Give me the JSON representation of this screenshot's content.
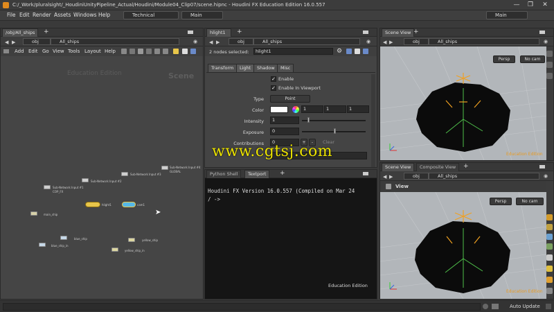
{
  "window": {
    "title": "C:/_Work/pluralsight/_HoudiniUnityPipeline_Actual/Houdini/Module04_Clip07/scene.hipnc - Houdini FX Education Edition 16.0.557"
  },
  "menubar": {
    "items": [
      "File",
      "Edit",
      "Render",
      "Assets",
      "Windows",
      "Help"
    ],
    "desktop": "Technical",
    "desktop2": "Main",
    "desktop_right": "Main"
  },
  "network": {
    "tab": "/obj/All_ships",
    "path_root": "obj",
    "path_node": "All_ships",
    "menu": [
      "Add",
      "Edit",
      "Go",
      "View",
      "Tools",
      "Layout",
      "Help"
    ],
    "watermark": "Education Edition",
    "context": "Scene",
    "nodes": [
      {
        "label": "Sub-Network Input #4",
        "sub": "GLOBAL"
      },
      {
        "label": "Sub-Network Input #3",
        "sub": ""
      },
      {
        "label": "Sub-Network Input #2",
        "sub": ""
      },
      {
        "label": "Sub-Network Input #1",
        "sub": "COP_FX"
      },
      {
        "label": "hlight1",
        "sub": ""
      },
      {
        "label": "cam1",
        "sub": ""
      },
      {
        "label": "main_ship",
        "sub": ""
      },
      {
        "label": "blue_ship",
        "sub": ""
      },
      {
        "label": "yellow_ship",
        "sub": ""
      },
      {
        "label": "blue_ship_in",
        "sub": ""
      },
      {
        "label": "yellow_ship_in",
        "sub": ""
      }
    ]
  },
  "params": {
    "tab": "hlight1",
    "path_root": "obj",
    "path_node": "All_ships",
    "selected": "2 nodes selected:",
    "node_name": "hlight1",
    "tabs": [
      "Transform",
      "Light",
      "Shadow",
      "Misc"
    ],
    "enable": "Enable",
    "enable_viewport": "Enable In Viewport",
    "type_label": "Type",
    "type_value": "Point",
    "color_label": "Color",
    "color_r": "1",
    "color_g": "1",
    "color_b": "1",
    "intensity_label": "Intensity",
    "intensity_value": "1",
    "exposure_label": "Exposure",
    "exposure_value": "0",
    "contributions_label": "Contributions",
    "contributions_value": "0",
    "clear": "Clear"
  },
  "shell": {
    "tabs": [
      "Python Shell",
      "Textport"
    ],
    "line1": "Houdini FX Version 16.0.557 (Compiled on Mar 24",
    "line2": "/ ->",
    "watermark": "Education Edition"
  },
  "scene_top": {
    "tab": "Scene View",
    "path_root": "obj",
    "path_node": "All_ships",
    "persp": "Persp",
    "cam": "No cam",
    "watermark": "Education Edition"
  },
  "scene_bottom": {
    "tab1": "Scene View",
    "tab2": "Composite View",
    "path_root": "obj",
    "path_node": "All_ships",
    "view_label": "View",
    "persp": "Persp",
    "cam": "No cam",
    "watermark": "Education Edition"
  },
  "statusbar": {
    "update": "Auto Update"
  },
  "overlay": {
    "site": "www.cgtsj.com"
  },
  "colors": {
    "accent": "#e08a1e",
    "light_node": "#e8c64a",
    "cam_node": "#56b8e6"
  }
}
